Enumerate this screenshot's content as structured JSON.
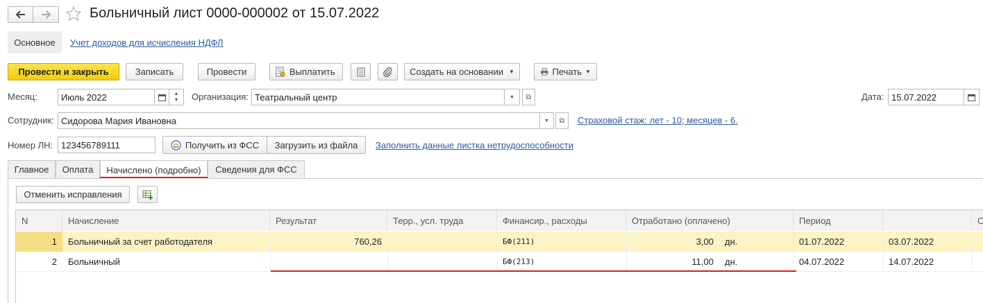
{
  "header": {
    "title": "Больничный лист 0000-000002 от 15.07.2022"
  },
  "section_tabs": {
    "main_label": "Основное",
    "ndfl_link": "Учет доходов для исчисления НДФЛ"
  },
  "toolbar": {
    "post_close": "Провести и закрыть",
    "save": "Записать",
    "post": "Провести",
    "pay": "Выплатить",
    "create_based": "Создать на основании",
    "print": "Печать"
  },
  "form": {
    "month_label": "Месяц:",
    "month_value": "Июль 2022",
    "org_label": "Организация:",
    "org_value": "Театральный центр",
    "date_label": "Дата:",
    "date_value": "15.07.2022",
    "employee_label": "Сотрудник:",
    "employee_value": "Сидорова Мария Ивановна",
    "insurance_link": "Страховой стаж: лет - 10; месяцев - 6.",
    "ln_label": "Номер ЛН:",
    "ln_value": "123456789111",
    "get_fss": "Получить из ФСС",
    "load_file": "Загрузить из файла",
    "fill_link": "Заполнить данные листка нетрудоспособности"
  },
  "tabs": [
    "Главное",
    "Оплата",
    "Начислено (подробно)",
    "Сведения для ФСС"
  ],
  "active_tab": "Начислено (подробно)",
  "inner_toolbar": {
    "cancel_corrections": "Отменить исправления"
  },
  "table": {
    "columns": [
      "N",
      "Начисление",
      "Результат",
      "Терр., усл. труда",
      "Финансир., расходы",
      "Отработано (оплачено)",
      "Период",
      "",
      "О"
    ],
    "rows": [
      {
        "n": "1",
        "accrual": "Больничный за счет работодателя",
        "result": "760,26",
        "terr": "",
        "fin": "БФ(211)",
        "worked": "3,00",
        "unit": "дн.",
        "period_from": "01.07.2022",
        "period_to": "03.07.2022"
      },
      {
        "n": "2",
        "accrual": "Больничный",
        "result": "",
        "terr": "",
        "fin": "БФ(213)",
        "worked": "11,00",
        "unit": "дн.",
        "period_from": "04.07.2022",
        "period_to": "14.07.2022"
      }
    ]
  },
  "colors": {
    "primary_button": "#f2cc0c",
    "selected_row": "#fbf3c4",
    "link": "#2a5aa0",
    "annotation": "#e0191f"
  }
}
